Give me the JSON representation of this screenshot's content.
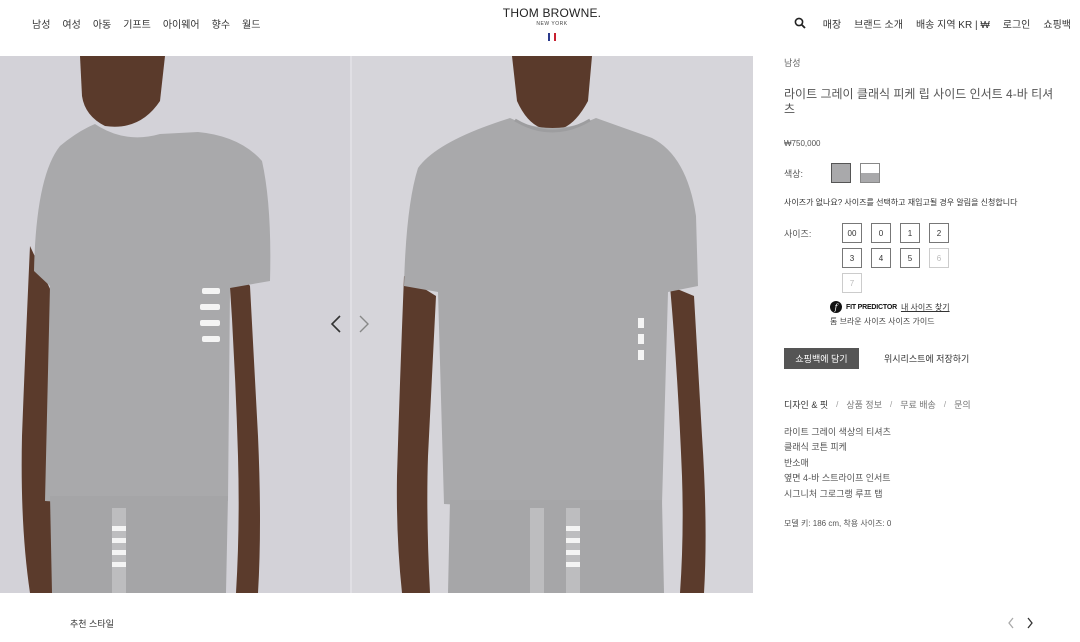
{
  "header": {
    "nav_left": [
      "남성",
      "여성",
      "아동",
      "기프트",
      "아이웨어",
      "향수",
      "월드"
    ],
    "logo": {
      "brand": "THOM BROWNE.",
      "city": "NEW YORK"
    },
    "flag_colors": [
      "#2b3a8c",
      "#ffffff",
      "#c8202f"
    ],
    "nav_right": [
      "매장",
      "브랜드 소개",
      "배송 지역 KR | ₩",
      "로그인",
      "쇼핑백"
    ]
  },
  "gallery": {
    "photos": [
      "photo-front-angle",
      "photo-front"
    ],
    "prev_arrow": "chevron-left-icon",
    "next_arrow": "chevron-right-icon"
  },
  "product": {
    "breadcrumb": "남성",
    "title": "라이트 그레이 클래식 피케 립 사이드 인서트 4-바 티셔츠",
    "price": "₩750,000",
    "color_label": "색상:",
    "colors": [
      "#a9a9ab",
      "gray-white-combo"
    ],
    "size_note": "사이즈가 없나요? 사이즈를 선택하고 재입고될 경우 알림을 신청합니다",
    "size_label": "사이즈:",
    "sizes": [
      {
        "label": "00",
        "available": true
      },
      {
        "label": "0",
        "available": true
      },
      {
        "label": "1",
        "available": true
      },
      {
        "label": "2",
        "available": true
      },
      {
        "label": "3",
        "available": true
      },
      {
        "label": "4",
        "available": true
      },
      {
        "label": "5",
        "available": true
      },
      {
        "label": "6",
        "available": false
      },
      {
        "label": "7",
        "available": false
      }
    ],
    "fit_predictor": {
      "brand": "FIT PREDICTOR",
      "link": "내 사이즈 찾기"
    },
    "size_guide": "톰 브라운 사이즈 사이즈 가이드",
    "add_to_bag": "쇼핑백에 담기",
    "wishlist": "위시리스트에 저장하기",
    "tabs": [
      "디자인 & 핏",
      "상품 정보",
      "무료 배송",
      "문의"
    ],
    "tab_separator": "/",
    "details": [
      "라이트 그레이 색상의 티셔츠",
      "클래식 코튼 피케",
      "반소매",
      "옆면 4-바 스트라이프 인서트",
      "시그니처 그로그랭 루프 탭"
    ],
    "model_info": "모델 키: 186 cm, 착용 사이즈: 0"
  },
  "bottom": {
    "recommend_title": "추천 스타일"
  }
}
